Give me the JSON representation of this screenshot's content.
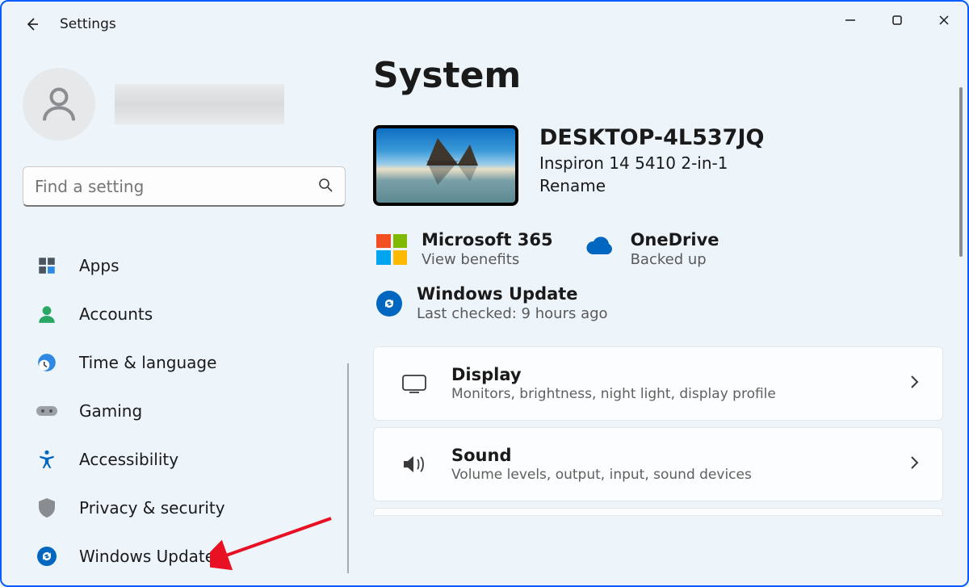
{
  "app": {
    "title": "Settings"
  },
  "search": {
    "placeholder": "Find a setting"
  },
  "sidebar": {
    "items": [
      {
        "label": "Apps"
      },
      {
        "label": "Accounts"
      },
      {
        "label": "Time & language"
      },
      {
        "label": "Gaming"
      },
      {
        "label": "Accessibility"
      },
      {
        "label": "Privacy & security"
      },
      {
        "label": "Windows Update"
      }
    ]
  },
  "page": {
    "title": "System"
  },
  "device": {
    "name": "DESKTOP-4L537JQ",
    "model": "Inspiron 14 5410 2-in-1",
    "rename": "Rename"
  },
  "cards": {
    "m365": {
      "title": "Microsoft 365",
      "sub": "View benefits"
    },
    "onedrive": {
      "title": "OneDrive",
      "sub": "Backed up"
    },
    "wu": {
      "title": "Windows Update",
      "sub": "Last checked: 9 hours ago"
    }
  },
  "settings": [
    {
      "title": "Display",
      "sub": "Monitors, brightness, night light, display profile"
    },
    {
      "title": "Sound",
      "sub": "Volume levels, output, input, sound devices"
    }
  ]
}
